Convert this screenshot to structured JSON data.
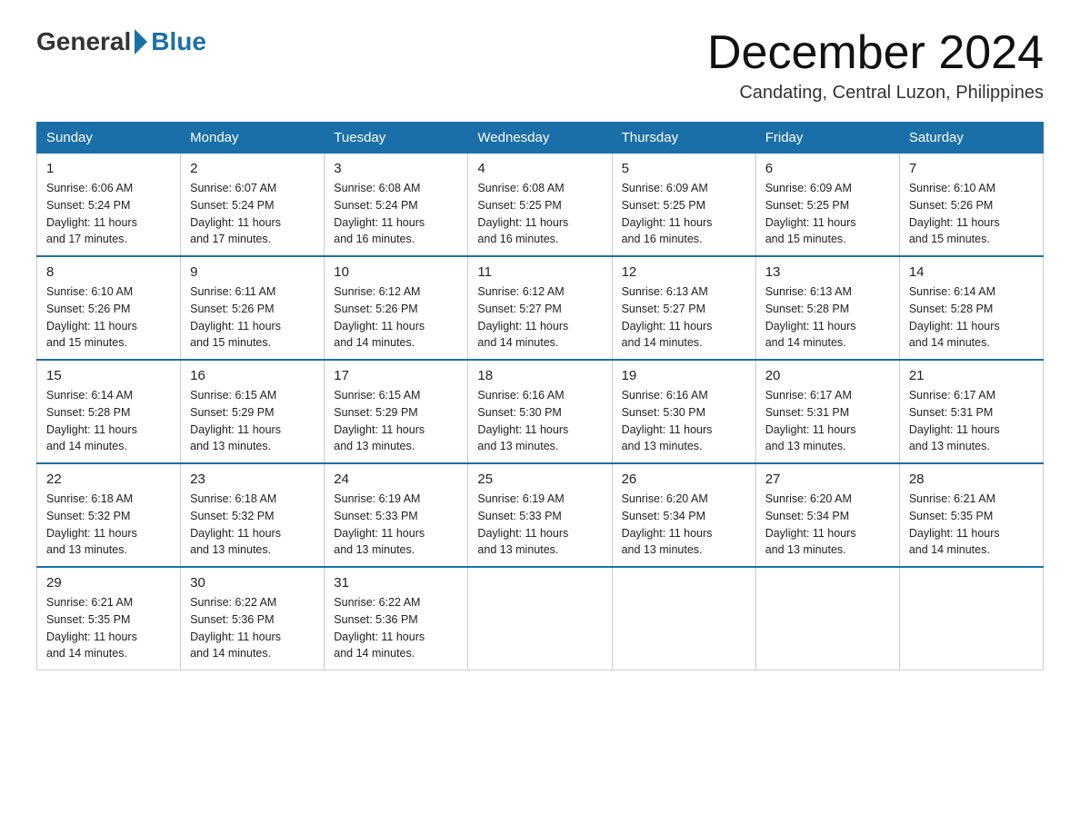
{
  "header": {
    "logo_general": "General",
    "logo_blue": "Blue",
    "month_year": "December 2024",
    "location": "Candating, Central Luzon, Philippines"
  },
  "days_of_week": [
    "Sunday",
    "Monday",
    "Tuesday",
    "Wednesday",
    "Thursday",
    "Friday",
    "Saturday"
  ],
  "weeks": [
    [
      {
        "day": "1",
        "info": "Sunrise: 6:06 AM\nSunset: 5:24 PM\nDaylight: 11 hours\nand 17 minutes."
      },
      {
        "day": "2",
        "info": "Sunrise: 6:07 AM\nSunset: 5:24 PM\nDaylight: 11 hours\nand 17 minutes."
      },
      {
        "day": "3",
        "info": "Sunrise: 6:08 AM\nSunset: 5:24 PM\nDaylight: 11 hours\nand 16 minutes."
      },
      {
        "day": "4",
        "info": "Sunrise: 6:08 AM\nSunset: 5:25 PM\nDaylight: 11 hours\nand 16 minutes."
      },
      {
        "day": "5",
        "info": "Sunrise: 6:09 AM\nSunset: 5:25 PM\nDaylight: 11 hours\nand 16 minutes."
      },
      {
        "day": "6",
        "info": "Sunrise: 6:09 AM\nSunset: 5:25 PM\nDaylight: 11 hours\nand 15 minutes."
      },
      {
        "day": "7",
        "info": "Sunrise: 6:10 AM\nSunset: 5:26 PM\nDaylight: 11 hours\nand 15 minutes."
      }
    ],
    [
      {
        "day": "8",
        "info": "Sunrise: 6:10 AM\nSunset: 5:26 PM\nDaylight: 11 hours\nand 15 minutes."
      },
      {
        "day": "9",
        "info": "Sunrise: 6:11 AM\nSunset: 5:26 PM\nDaylight: 11 hours\nand 15 minutes."
      },
      {
        "day": "10",
        "info": "Sunrise: 6:12 AM\nSunset: 5:26 PM\nDaylight: 11 hours\nand 14 minutes."
      },
      {
        "day": "11",
        "info": "Sunrise: 6:12 AM\nSunset: 5:27 PM\nDaylight: 11 hours\nand 14 minutes."
      },
      {
        "day": "12",
        "info": "Sunrise: 6:13 AM\nSunset: 5:27 PM\nDaylight: 11 hours\nand 14 minutes."
      },
      {
        "day": "13",
        "info": "Sunrise: 6:13 AM\nSunset: 5:28 PM\nDaylight: 11 hours\nand 14 minutes."
      },
      {
        "day": "14",
        "info": "Sunrise: 6:14 AM\nSunset: 5:28 PM\nDaylight: 11 hours\nand 14 minutes."
      }
    ],
    [
      {
        "day": "15",
        "info": "Sunrise: 6:14 AM\nSunset: 5:28 PM\nDaylight: 11 hours\nand 14 minutes."
      },
      {
        "day": "16",
        "info": "Sunrise: 6:15 AM\nSunset: 5:29 PM\nDaylight: 11 hours\nand 13 minutes."
      },
      {
        "day": "17",
        "info": "Sunrise: 6:15 AM\nSunset: 5:29 PM\nDaylight: 11 hours\nand 13 minutes."
      },
      {
        "day": "18",
        "info": "Sunrise: 6:16 AM\nSunset: 5:30 PM\nDaylight: 11 hours\nand 13 minutes."
      },
      {
        "day": "19",
        "info": "Sunrise: 6:16 AM\nSunset: 5:30 PM\nDaylight: 11 hours\nand 13 minutes."
      },
      {
        "day": "20",
        "info": "Sunrise: 6:17 AM\nSunset: 5:31 PM\nDaylight: 11 hours\nand 13 minutes."
      },
      {
        "day": "21",
        "info": "Sunrise: 6:17 AM\nSunset: 5:31 PM\nDaylight: 11 hours\nand 13 minutes."
      }
    ],
    [
      {
        "day": "22",
        "info": "Sunrise: 6:18 AM\nSunset: 5:32 PM\nDaylight: 11 hours\nand 13 minutes."
      },
      {
        "day": "23",
        "info": "Sunrise: 6:18 AM\nSunset: 5:32 PM\nDaylight: 11 hours\nand 13 minutes."
      },
      {
        "day": "24",
        "info": "Sunrise: 6:19 AM\nSunset: 5:33 PM\nDaylight: 11 hours\nand 13 minutes."
      },
      {
        "day": "25",
        "info": "Sunrise: 6:19 AM\nSunset: 5:33 PM\nDaylight: 11 hours\nand 13 minutes."
      },
      {
        "day": "26",
        "info": "Sunrise: 6:20 AM\nSunset: 5:34 PM\nDaylight: 11 hours\nand 13 minutes."
      },
      {
        "day": "27",
        "info": "Sunrise: 6:20 AM\nSunset: 5:34 PM\nDaylight: 11 hours\nand 13 minutes."
      },
      {
        "day": "28",
        "info": "Sunrise: 6:21 AM\nSunset: 5:35 PM\nDaylight: 11 hours\nand 14 minutes."
      }
    ],
    [
      {
        "day": "29",
        "info": "Sunrise: 6:21 AM\nSunset: 5:35 PM\nDaylight: 11 hours\nand 14 minutes."
      },
      {
        "day": "30",
        "info": "Sunrise: 6:22 AM\nSunset: 5:36 PM\nDaylight: 11 hours\nand 14 minutes."
      },
      {
        "day": "31",
        "info": "Sunrise: 6:22 AM\nSunset: 5:36 PM\nDaylight: 11 hours\nand 14 minutes."
      },
      {
        "day": "",
        "info": ""
      },
      {
        "day": "",
        "info": ""
      },
      {
        "day": "",
        "info": ""
      },
      {
        "day": "",
        "info": ""
      }
    ]
  ]
}
